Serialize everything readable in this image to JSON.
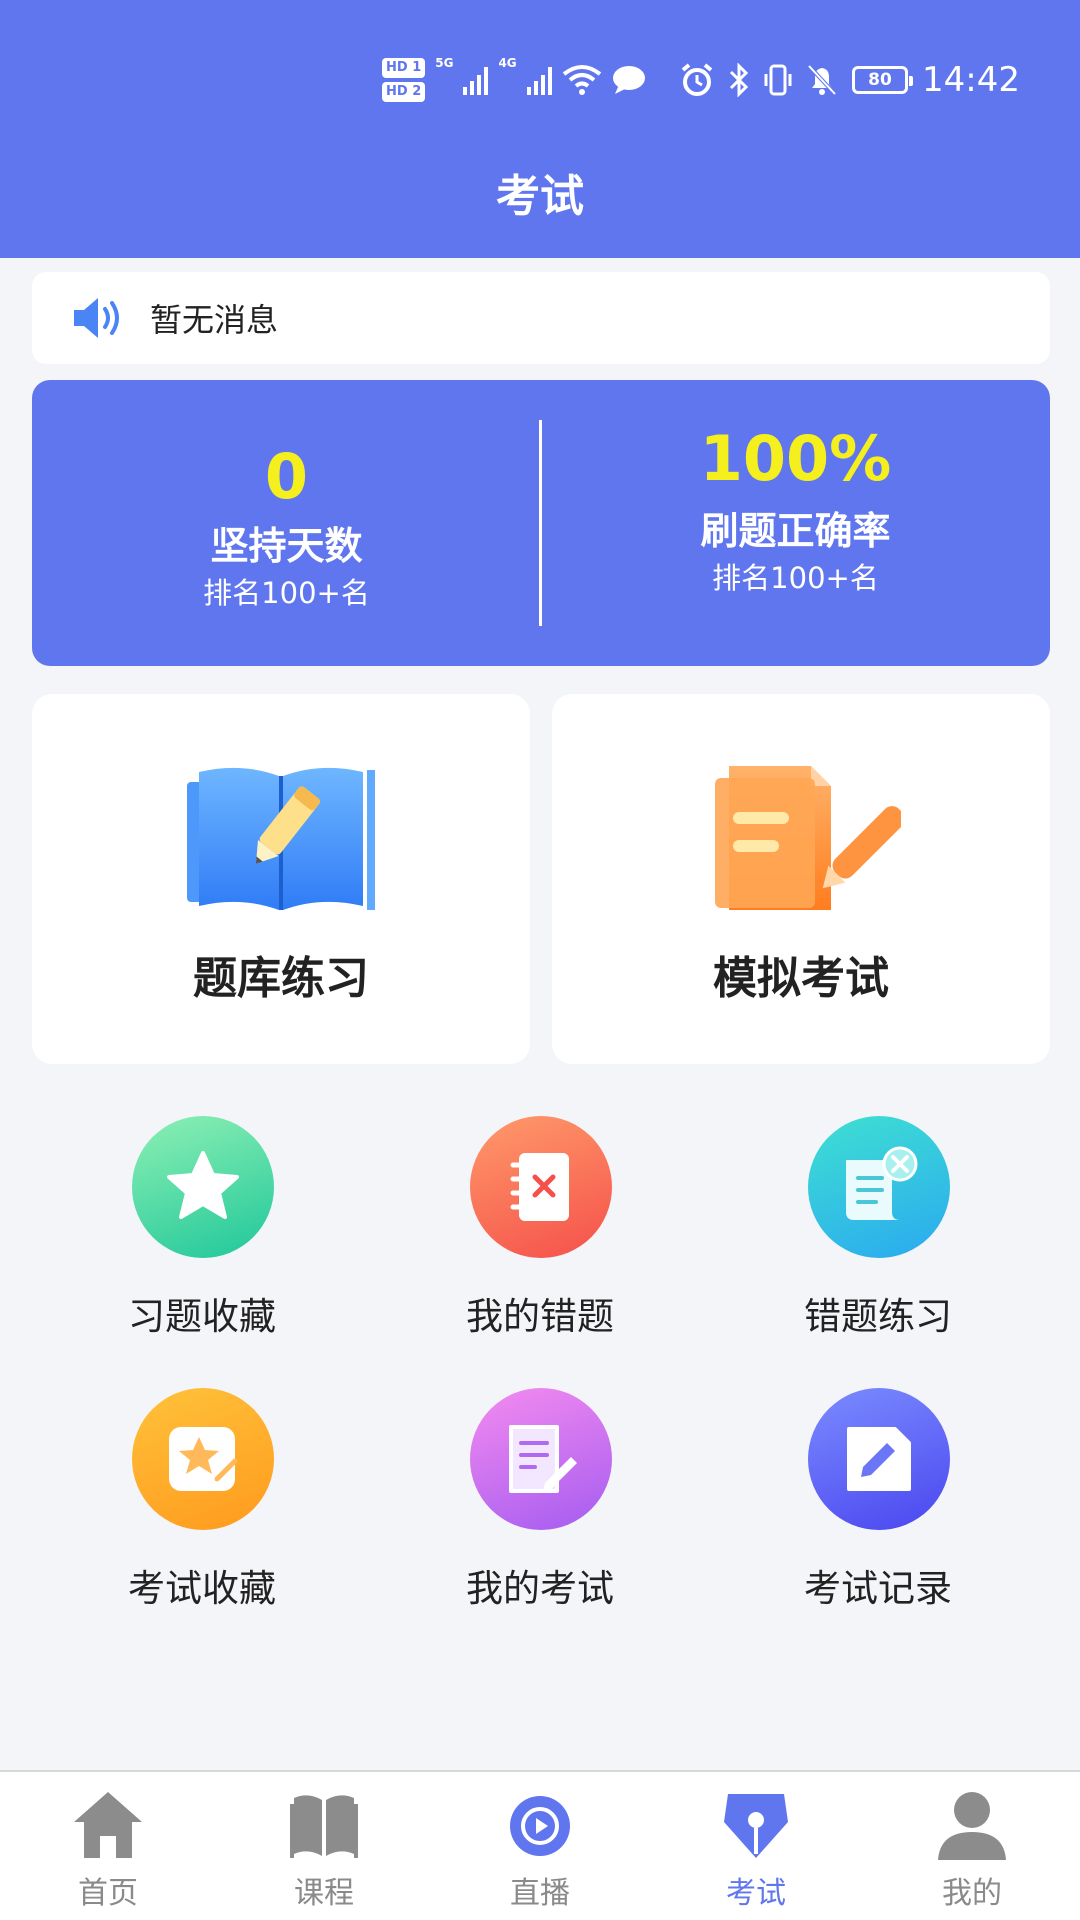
{
  "status_bar": {
    "hd1": "HD 1",
    "hd2": "HD 2",
    "net1": "5G",
    "net2": "4G",
    "battery": "80",
    "time": "14:42"
  },
  "header": {
    "title": "考试"
  },
  "notice": {
    "text": "暂无消息"
  },
  "stats": {
    "left": {
      "value": "0",
      "label": "坚持天数",
      "rank": "排名100+名"
    },
    "right": {
      "value": "100%",
      "label": "刷题正确率",
      "rank": "排名100+名"
    },
    "value_color": "#f4ef1d"
  },
  "cards": [
    {
      "label": "题库练习",
      "icon": "open-book-pencil-icon"
    },
    {
      "label": "模拟考试",
      "icon": "document-pen-icon"
    }
  ],
  "tiles": [
    {
      "label": "习题收藏",
      "icon": "star-icon"
    },
    {
      "label": "我的错题",
      "icon": "notebook-x-icon"
    },
    {
      "label": "错题练习",
      "icon": "scroll-x-icon"
    },
    {
      "label": "考试收藏",
      "icon": "note-star-icon"
    },
    {
      "label": "我的考试",
      "icon": "document-pencil-icon"
    },
    {
      "label": "考试记录",
      "icon": "edit-note-icon"
    }
  ],
  "bottom_nav": [
    {
      "label": "首页",
      "icon": "home-icon"
    },
    {
      "label": "课程",
      "icon": "book-icon"
    },
    {
      "label": "直播",
      "icon": "live-play-icon"
    },
    {
      "label": "考试",
      "icon": "exam-pen-icon",
      "active": true
    },
    {
      "label": "我的",
      "icon": "user-icon"
    }
  ],
  "colors": {
    "brand": "#6076ef",
    "background": "#f4f5f9",
    "nav_inactive": "#8a8a8a"
  }
}
